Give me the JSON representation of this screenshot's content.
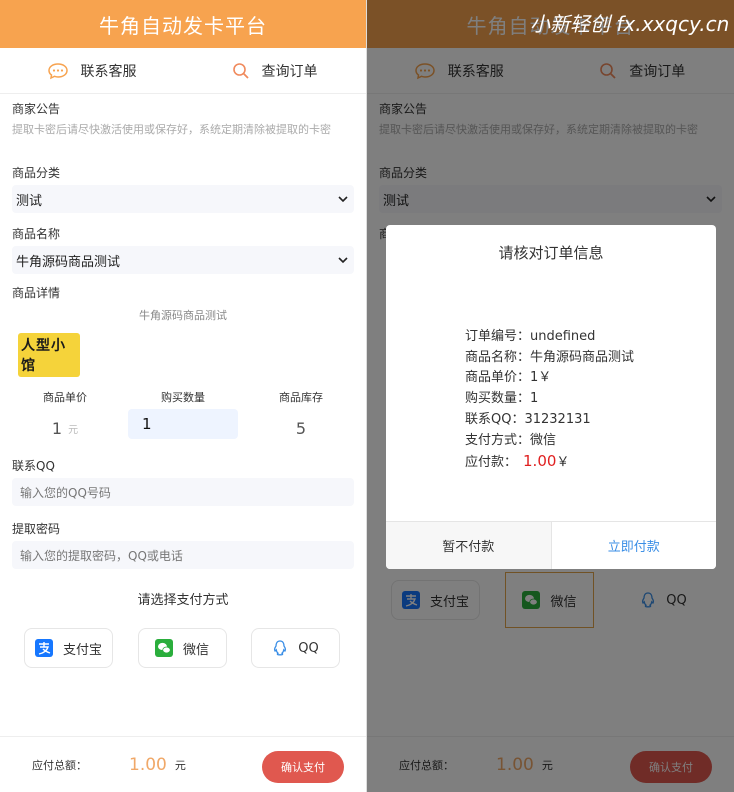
{
  "header": {
    "title": "牛角自动发卡平台"
  },
  "nav": {
    "contact": "联系客服",
    "query": "查询订单"
  },
  "notice": {
    "label": "商家公告",
    "text": "提取卡密后请尽快激活使用或保存好，系统定期清除被提取的卡密"
  },
  "category": {
    "label": "商品分类",
    "value": "测试"
  },
  "product": {
    "label": "商品名称",
    "value": "牛角源码商品测试"
  },
  "detail": {
    "label": "商品详情",
    "title": "牛角源码商品测试",
    "logo_text": "人型小馆"
  },
  "stats": {
    "price_label": "商品单价",
    "price": "1",
    "price_unit": "元",
    "qty_label": "购买数量",
    "qty": "1",
    "stock_label": "商品库存",
    "stock": "5"
  },
  "qq": {
    "label": "联系QQ",
    "placeholder": "输入您的QQ号码"
  },
  "pwd": {
    "label": "提取密码",
    "placeholder": "输入您的提取密码，QQ或电话"
  },
  "pay": {
    "title": "请选择支付方式",
    "alipay": "支付宝",
    "wechat": "微信",
    "qq": "QQ"
  },
  "footer": {
    "label": "应付总额：",
    "amount": "1.00",
    "unit": "元",
    "button": "确认支付"
  },
  "watermark": "小新轻创 fx.xxqcy.cn",
  "modal": {
    "title": "请核对订单信息",
    "order_no": "订单编号：undefined",
    "product": "商品名称：牛角源码商品测试",
    "price": "商品单价：1￥",
    "qty": "购买数量：1",
    "qq": "联系QQ：31232131",
    "method": "支付方式：微信",
    "due_label": "应付款：",
    "due_amount": "1.00",
    "due_unit": "￥",
    "cancel": "暂不付款",
    "ok": "立即付款"
  },
  "colors": {
    "accent": "#f7a34f",
    "confirm": "#e0584f",
    "link": "#3a8ee6",
    "alipay": "#1677ff",
    "wechat": "#2aae3c",
    "qq": "#3a8ee6"
  },
  "icons": {
    "contact": "chat-bubble-icon",
    "query": "search-icon",
    "alipay": "alipay-icon",
    "wechat": "wechat-icon",
    "qq": "qq-icon"
  }
}
